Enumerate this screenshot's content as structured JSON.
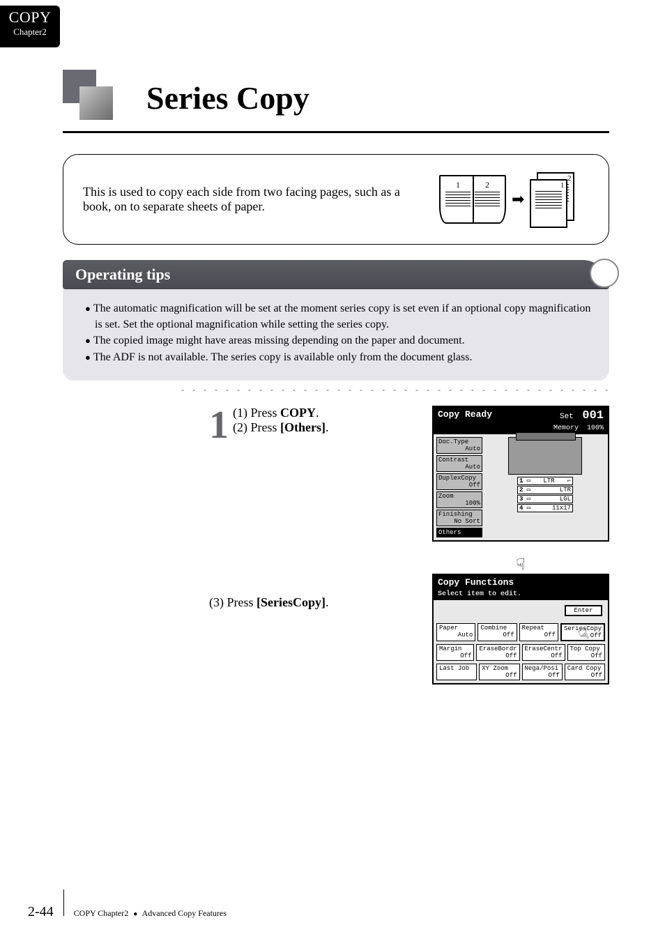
{
  "tab": {
    "title": "COPY",
    "chapter": "Chapter2"
  },
  "heading": "Series Copy",
  "intro": "This is used to copy each side from two facing pages, such as a book, on to separate sheets of paper.",
  "diagram": {
    "bookLeft": "1",
    "bookRight": "2",
    "arrow": "➡",
    "sheetBack": "2",
    "sheetFront": "1"
  },
  "opTipsTitle": "Operating tips",
  "tips": [
    "The automatic magnification will be set at the moment series copy is set even if an optional copy magnification is set. Set the optional magnification while setting the series copy.",
    "The copied image might have areas missing depending on the paper and document.",
    "The ADF is not available. The series copy is available only from the document glass."
  ],
  "bigStep": "1",
  "steps": {
    "s1a_prefix": "(1) Press ",
    "s1a_target": "COPY",
    "s1a_suffix": ".",
    "s1b_prefix": "(2) Press ",
    "s1b_target": "[Others]",
    "s1b_suffix": ".",
    "s3_prefix": "(3) Press ",
    "s3_target": "[SeriesCopy]",
    "s3_suffix": "."
  },
  "screen1": {
    "title": "Copy Ready",
    "setLabel": "Set",
    "setValue": "001",
    "memLabel": "Memory",
    "memValue": "100%",
    "side": [
      {
        "name": "Doc.Type",
        "value": "Auto"
      },
      {
        "name": "Contrast",
        "value": "Auto"
      },
      {
        "name": "DuplexCopy",
        "value": "Off"
      },
      {
        "name": "Zoom",
        "value": "100%"
      },
      {
        "name": "Finishing",
        "value": "No Sort"
      },
      {
        "name": "Others",
        "value": ""
      }
    ],
    "trays": [
      {
        "idx": "1",
        "size": "LTR",
        "orient": "⌐"
      },
      {
        "idx": "2",
        "size": "LTR",
        "orient": ""
      },
      {
        "idx": "3",
        "size": "LGL",
        "orient": ""
      },
      {
        "idx": "4",
        "size": "11x17",
        "orient": ""
      }
    ],
    "hand": "☟"
  },
  "screen2": {
    "title": "Copy Functions",
    "subtitle": "Select item to edit.",
    "enter": "Enter",
    "rows": [
      [
        {
          "name": "Paper",
          "value": "Auto"
        },
        {
          "name": "Combine",
          "value": "Off"
        },
        {
          "name": "Repeat",
          "value": "Off"
        },
        {
          "name": "SeriesCopy",
          "value": "Off",
          "highlight": true
        }
      ],
      [
        {
          "name": "Margin",
          "value": "Off"
        },
        {
          "name": "EraseBordr",
          "value": "Off"
        },
        {
          "name": "EraseCentr",
          "value": "Off"
        },
        {
          "name": "Top Copy",
          "value": "Off"
        }
      ],
      [
        {
          "name": "Last Job",
          "value": ""
        },
        {
          "name": "XY Zoom",
          "value": "Off"
        },
        {
          "name": "Nega/Posi",
          "value": "Off"
        },
        {
          "name": "Card Copy",
          "value": "Off"
        }
      ]
    ],
    "hand": "☟"
  },
  "footer": {
    "page": "2-44",
    "crumb1": "COPY Chapter2",
    "dot": "●",
    "crumb2": "Advanced Copy Features"
  }
}
